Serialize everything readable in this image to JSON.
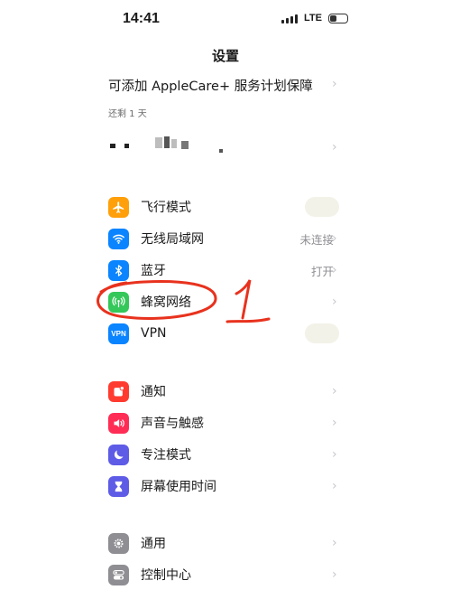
{
  "status_bar": {
    "time": "14:41",
    "network": "LTE",
    "battery_level": 0.4
  },
  "title": "设置",
  "applecare": {
    "label": "可添加 AppleCare+ 服务计划保障",
    "remaining": "还剩 1 天"
  },
  "group1": [
    {
      "icon": "airplane-icon",
      "label": "飞行模式",
      "value": "",
      "color": "#ff9f0a",
      "toggle": true
    },
    {
      "icon": "wifi-icon",
      "label": "无线局域网",
      "value": "未连接",
      "color": "#0a84ff",
      "toggle": false
    },
    {
      "icon": "bluetooth-icon",
      "label": "蓝牙",
      "value": "打开",
      "color": "#0a84ff",
      "toggle": false
    },
    {
      "icon": "cellular-icon",
      "label": "蜂窝网络",
      "value": "",
      "color": "#34c759",
      "toggle": false
    },
    {
      "icon": "vpn-icon",
      "label": "VPN",
      "value": "",
      "color": "#0a84ff",
      "toggle": true
    }
  ],
  "group2": [
    {
      "icon": "notification-icon",
      "label": "通知",
      "color": "#ff3b30"
    },
    {
      "icon": "sound-icon",
      "label": "声音与触感",
      "color": "#ff2d55"
    },
    {
      "icon": "moon-icon",
      "label": "专注模式",
      "color": "#5e5ce6"
    },
    {
      "icon": "hourglass-icon",
      "label": "屏幕使用时间",
      "color": "#5e5ce6"
    }
  ],
  "group3": [
    {
      "icon": "gear-icon",
      "label": "通用",
      "color": "#8e8e93"
    },
    {
      "icon": "toggles-icon",
      "label": "控制中心",
      "color": "#8e8e93"
    }
  ],
  "vpn_icon_text": "VPN",
  "annotation_number": "1",
  "chevron": "›"
}
